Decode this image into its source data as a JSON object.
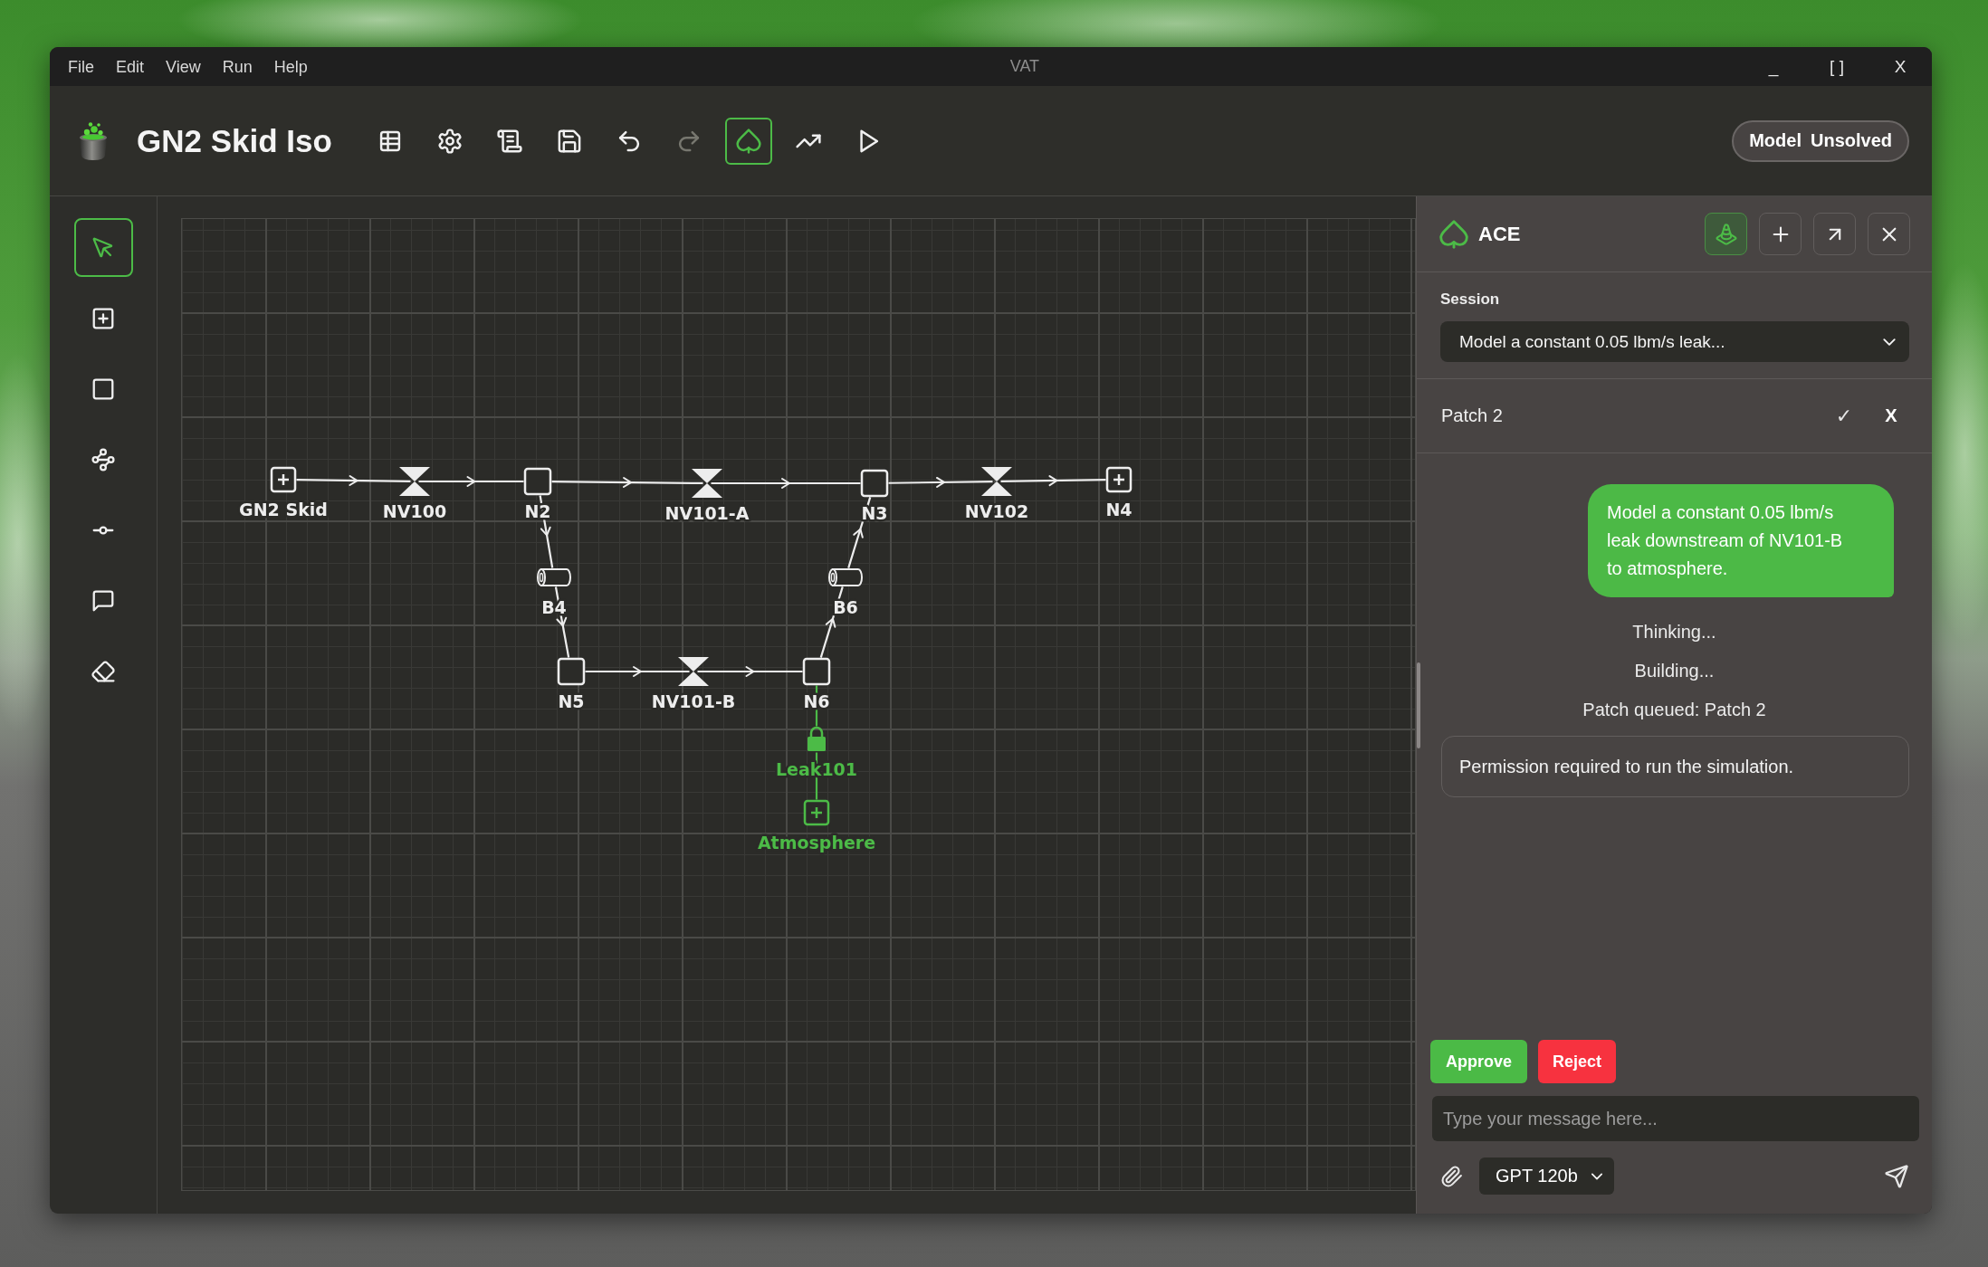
{
  "window": {
    "menu": [
      "File",
      "Edit",
      "View",
      "Run",
      "Help"
    ],
    "title": "VAT",
    "controls": [
      "_",
      "[ ]",
      "X"
    ]
  },
  "header": {
    "title": "GN2 Skid Iso",
    "toolbar": [
      {
        "kind": "table",
        "selected": false,
        "disabled": false
      },
      {
        "kind": "settings",
        "selected": false,
        "disabled": false
      },
      {
        "kind": "script",
        "selected": false,
        "disabled": false
      },
      {
        "kind": "save",
        "selected": false,
        "disabled": false
      },
      {
        "kind": "undo",
        "selected": false,
        "disabled": false
      },
      {
        "kind": "redo",
        "selected": false,
        "disabled": true
      },
      {
        "kind": "assistant",
        "selected": true,
        "disabled": false
      },
      {
        "kind": "trend",
        "selected": false,
        "disabled": false
      },
      {
        "kind": "run",
        "selected": false,
        "disabled": false
      }
    ],
    "status": {
      "label": "Model",
      "value": "Unsolved"
    }
  },
  "tools": [
    {
      "kind": "select",
      "selected": true
    },
    {
      "kind": "boundary",
      "selected": false
    },
    {
      "kind": "node",
      "selected": false
    },
    {
      "kind": "network",
      "selected": false
    },
    {
      "kind": "connector",
      "selected": false
    },
    {
      "kind": "comment",
      "selected": false
    },
    {
      "kind": "eraser",
      "selected": false
    }
  ],
  "diagram": {
    "nodes": [
      {
        "label": "GN2 Skid",
        "kind": "boundary",
        "proposed": false
      },
      {
        "label": "NV100",
        "kind": "valve",
        "proposed": false
      },
      {
        "label": "N2",
        "kind": "junction",
        "proposed": false
      },
      {
        "label": "NV101-A",
        "kind": "valve",
        "proposed": false
      },
      {
        "label": "N3",
        "kind": "junction",
        "proposed": false
      },
      {
        "label": "NV102",
        "kind": "valve",
        "proposed": false
      },
      {
        "label": "N4",
        "kind": "boundary",
        "proposed": false
      },
      {
        "label": "B4",
        "kind": "pipe",
        "proposed": false
      },
      {
        "label": "B6",
        "kind": "pipe",
        "proposed": false
      },
      {
        "label": "N5",
        "kind": "junction",
        "proposed": false
      },
      {
        "label": "NV101-B",
        "kind": "valve",
        "proposed": false
      },
      {
        "label": "N6",
        "kind": "junction",
        "proposed": false
      },
      {
        "label": "Leak101",
        "kind": "leak",
        "proposed": true
      },
      {
        "label": "Atmosphere",
        "kind": "boundary",
        "proposed": true
      }
    ],
    "connections": [
      {
        "arrow": true,
        "proposed": false
      },
      {
        "arrow": true,
        "proposed": false
      },
      {
        "arrow": true,
        "proposed": false
      },
      {
        "arrow": true,
        "proposed": false
      },
      {
        "arrow": true,
        "proposed": false
      },
      {
        "arrow": true,
        "proposed": false
      },
      {
        "arrow": true,
        "proposed": false
      },
      {
        "arrow": true,
        "proposed": false
      },
      {
        "arrow": true,
        "proposed": false
      },
      {
        "arrow": true,
        "proposed": false
      },
      {
        "arrow": true,
        "proposed": false
      },
      {
        "arrow": true,
        "proposed": false
      },
      {
        "arrow": false,
        "proposed": true
      },
      {
        "arrow": false,
        "proposed": true
      }
    ]
  },
  "assistant": {
    "title": "ACE",
    "buttons": [
      {
        "kind": "cone",
        "selected": true
      },
      {
        "kind": "new",
        "selected": false
      },
      {
        "kind": "popout",
        "selected": false
      },
      {
        "kind": "close",
        "selected": false
      }
    ],
    "session": {
      "label": "Session",
      "value": "Model a constant 0.05 lbm/s leak..."
    },
    "patch": {
      "name": "Patch 2",
      "accept": "✓",
      "reject": "X"
    },
    "messages": [
      {
        "kind": "user",
        "text": "Model a constant 0.05 lbm/s leak downstream of NV101-B to atmosphere."
      },
      {
        "kind": "status",
        "text": "Thinking..."
      },
      {
        "kind": "status",
        "text": "Building..."
      },
      {
        "kind": "status",
        "text": "Patch queued: Patch 2"
      },
      {
        "kind": "notice",
        "text": "Permission required to run the simulation."
      }
    ],
    "actions": [
      {
        "kind": "approve",
        "label": "Approve"
      },
      {
        "kind": "reject",
        "label": "Reject"
      }
    ],
    "input": {
      "placeholder": "Type your message here..."
    },
    "model": "GPT 120b"
  }
}
